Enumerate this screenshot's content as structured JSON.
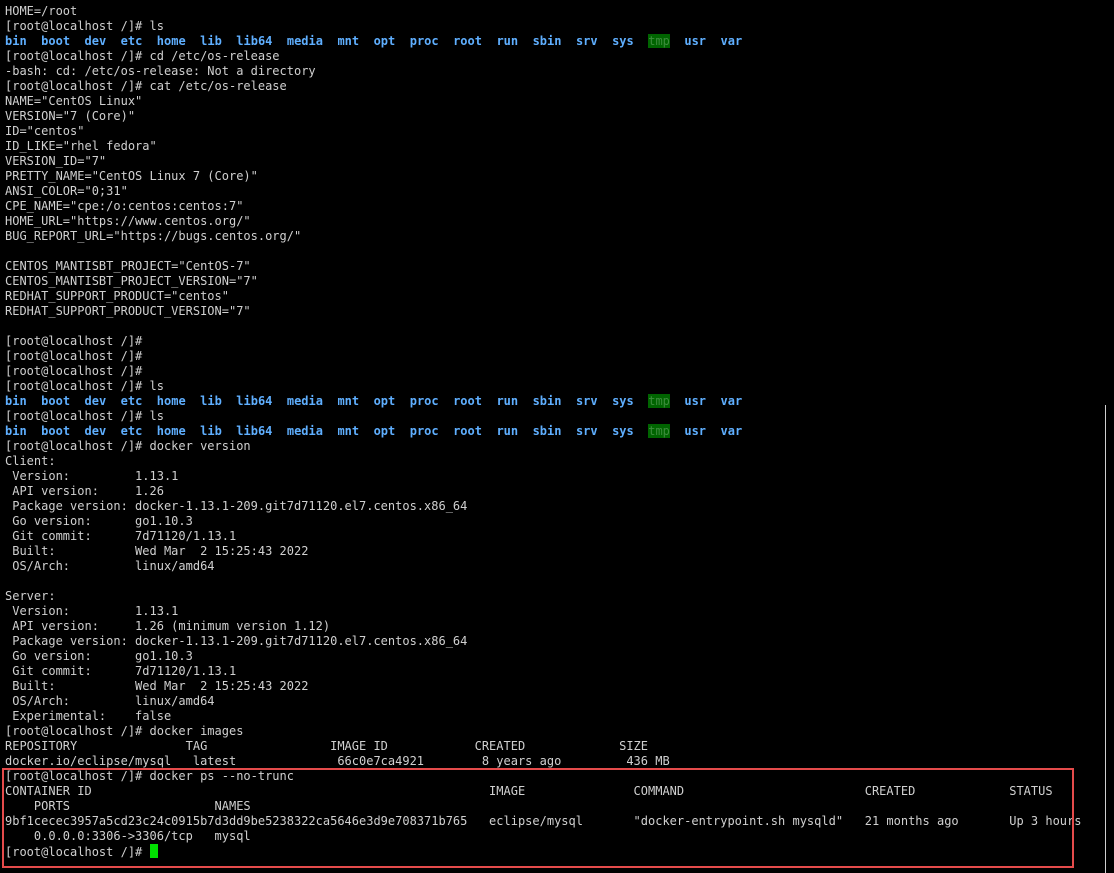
{
  "terminal": {
    "lines": [
      {
        "type": "text",
        "text": "HOME=/root"
      },
      {
        "type": "text",
        "text": "[root@localhost /]# ls"
      },
      {
        "type": "ls"
      },
      {
        "type": "text",
        "text": "[root@localhost /]# cd /etc/os-release"
      },
      {
        "type": "text",
        "text": "-bash: cd: /etc/os-release: Not a directory"
      },
      {
        "type": "text",
        "text": "[root@localhost /]# cat /etc/os-release"
      },
      {
        "type": "text",
        "text": "NAME=\"CentOS Linux\""
      },
      {
        "type": "text",
        "text": "VERSION=\"7 (Core)\""
      },
      {
        "type": "text",
        "text": "ID=\"centos\""
      },
      {
        "type": "text",
        "text": "ID_LIKE=\"rhel fedora\""
      },
      {
        "type": "text",
        "text": "VERSION_ID=\"7\""
      },
      {
        "type": "text",
        "text": "PRETTY_NAME=\"CentOS Linux 7 (Core)\""
      },
      {
        "type": "text",
        "text": "ANSI_COLOR=\"0;31\""
      },
      {
        "type": "text",
        "text": "CPE_NAME=\"cpe:/o:centos:centos:7\""
      },
      {
        "type": "text",
        "text": "HOME_URL=\"https://www.centos.org/\""
      },
      {
        "type": "text",
        "text": "BUG_REPORT_URL=\"https://bugs.centos.org/\""
      },
      {
        "type": "text",
        "text": ""
      },
      {
        "type": "text",
        "text": "CENTOS_MANTISBT_PROJECT=\"CentOS-7\""
      },
      {
        "type": "text",
        "text": "CENTOS_MANTISBT_PROJECT_VERSION=\"7\""
      },
      {
        "type": "text",
        "text": "REDHAT_SUPPORT_PRODUCT=\"centos\""
      },
      {
        "type": "text",
        "text": "REDHAT_SUPPORT_PRODUCT_VERSION=\"7\""
      },
      {
        "type": "text",
        "text": ""
      },
      {
        "type": "text",
        "text": "[root@localhost /]#"
      },
      {
        "type": "text",
        "text": "[root@localhost /]#"
      },
      {
        "type": "text",
        "text": "[root@localhost /]#"
      },
      {
        "type": "text",
        "text": "[root@localhost /]# ls"
      },
      {
        "type": "ls"
      },
      {
        "type": "text",
        "text": "[root@localhost /]# ls"
      },
      {
        "type": "ls"
      },
      {
        "type": "text",
        "text": "[root@localhost /]# docker version"
      },
      {
        "type": "text",
        "text": "Client:"
      },
      {
        "type": "text",
        "text": " Version:         1.13.1"
      },
      {
        "type": "text",
        "text": " API version:     1.26"
      },
      {
        "type": "text",
        "text": " Package version: docker-1.13.1-209.git7d71120.el7.centos.x86_64"
      },
      {
        "type": "text",
        "text": " Go version:      go1.10.3"
      },
      {
        "type": "text",
        "text": " Git commit:      7d71120/1.13.1"
      },
      {
        "type": "text",
        "text": " Built:           Wed Mar  2 15:25:43 2022"
      },
      {
        "type": "text",
        "text": " OS/Arch:         linux/amd64"
      },
      {
        "type": "text",
        "text": ""
      },
      {
        "type": "text",
        "text": "Server:"
      },
      {
        "type": "text",
        "text": " Version:         1.13.1"
      },
      {
        "type": "text",
        "text": " API version:     1.26 (minimum version 1.12)"
      },
      {
        "type": "text",
        "text": " Package version: docker-1.13.1-209.git7d71120.el7.centos.x86_64"
      },
      {
        "type": "text",
        "text": " Go version:      go1.10.3"
      },
      {
        "type": "text",
        "text": " Git commit:      7d71120/1.13.1"
      },
      {
        "type": "text",
        "text": " Built:           Wed Mar  2 15:25:43 2022"
      },
      {
        "type": "text",
        "text": " OS/Arch:         linux/amd64"
      },
      {
        "type": "text",
        "text": " Experimental:    false"
      },
      {
        "type": "text",
        "text": "[root@localhost /]# docker images"
      },
      {
        "type": "text",
        "text": "REPOSITORY               TAG                 IMAGE ID            CREATED             SIZE"
      },
      {
        "type": "text",
        "text": "docker.io/eclipse/mysql   latest              66c0e7ca4921        8 years ago         436 MB"
      },
      {
        "type": "text",
        "text": "[root@localhost /]# docker ps --no-trunc"
      },
      {
        "type": "text",
        "text": "CONTAINER ID                                                       IMAGE               COMMAND                         CREATED             STATUS"
      },
      {
        "type": "text",
        "text": "    PORTS                    NAMES"
      },
      {
        "type": "text",
        "text": "9bf1cecec3957a5cd23c24c0915b7d3dd9be5238322ca5646e3d9e708371b765   eclipse/mysql       \"docker-entrypoint.sh mysqld\"   21 months ago       Up 3 hours"
      },
      {
        "type": "text",
        "text": "    0.0.0.0:3306->3306/tcp   mysql"
      },
      {
        "type": "prompt",
        "text": "[root@localhost /]# "
      }
    ],
    "ls_entries": [
      "bin",
      "boot",
      "dev",
      "etc",
      "home",
      "lib",
      "lib64",
      "media",
      "mnt",
      "opt",
      "proc",
      "root",
      "run",
      "sbin",
      "srv",
      "sys",
      "tmp",
      "usr",
      "var"
    ]
  },
  "colors": {
    "background": "#000000",
    "text": "#d0d0d0",
    "directory": "#5fafff",
    "tmp_background": "#006400",
    "highlight_border": "#e54b4b",
    "cursor": "#00e000"
  }
}
